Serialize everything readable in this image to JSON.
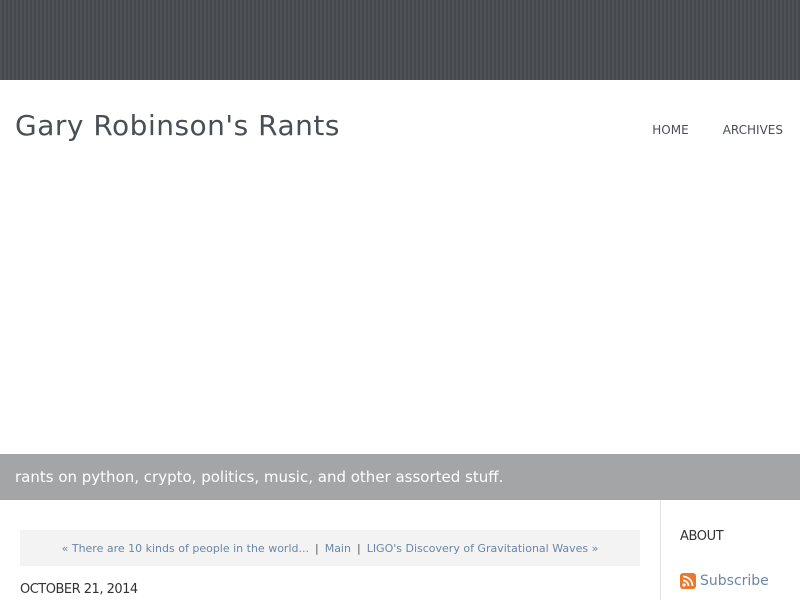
{
  "header": {
    "site_title": "Gary Robinson's Rants",
    "nav": {
      "home": "HOME",
      "archives": "ARCHIVES"
    }
  },
  "tagline": "rants on python, crypto, politics, music, and other assorted stuff.",
  "post": {
    "nav": {
      "prev": "« There are 10 kinds of people in the world...",
      "sep1": "|",
      "main": "Main",
      "sep2": "|",
      "next": "LIGO's Discovery of Gravitational Waves »"
    },
    "date": "OCTOBER 21, 2014"
  },
  "sidebar": {
    "heading": "ABOUT",
    "subscribe_label": "Subscribe",
    "subscribe_icon": "rss-icon"
  },
  "colors": {
    "banner": "#4a4d51",
    "tagline_bar": "#a3a5a7",
    "link": "#6b87a6",
    "rss": "#e8792d"
  }
}
